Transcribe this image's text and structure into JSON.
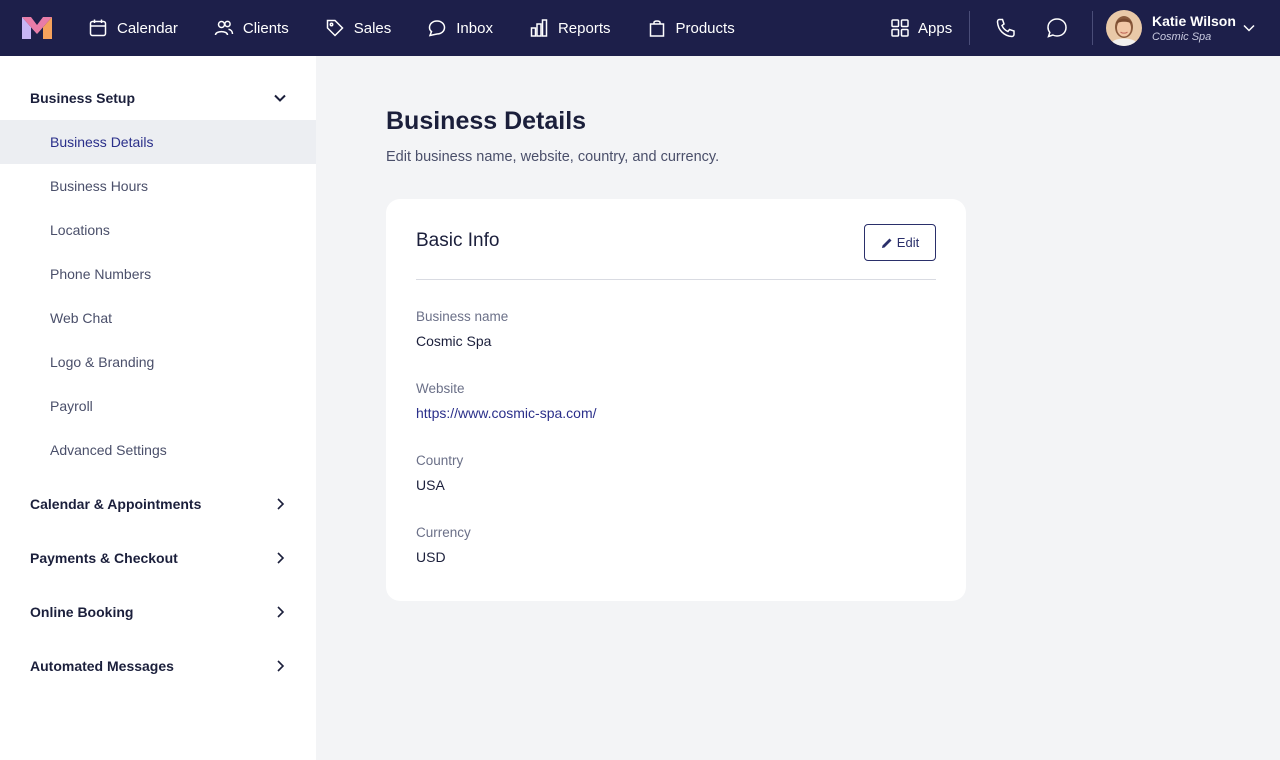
{
  "nav": {
    "items": [
      {
        "label": "Calendar",
        "icon": "calendar-icon"
      },
      {
        "label": "Clients",
        "icon": "users-icon"
      },
      {
        "label": "Sales",
        "icon": "tag-icon"
      },
      {
        "label": "Inbox",
        "icon": "chat-bubble-icon"
      },
      {
        "label": "Reports",
        "icon": "bar-chart-icon"
      },
      {
        "label": "Products",
        "icon": "shopping-bag-icon"
      }
    ],
    "apps_label": "Apps",
    "user_name": "Katie Wilson",
    "user_business": "Cosmic Spa",
    "bg_color": "#1d1f4a"
  },
  "sidebar": {
    "business_setup": "Business Setup",
    "items": [
      "Business Details",
      "Business Hours",
      "Locations",
      "Phone Numbers",
      "Web Chat",
      "Logo & Branding",
      "Payroll",
      "Advanced Settings"
    ],
    "sections": [
      "Calendar & Appointments",
      "Payments & Checkout",
      "Online Booking",
      "Automated Messages"
    ]
  },
  "main": {
    "title": "Business Details",
    "subtitle": "Edit business name, website, country, and currency.",
    "card": {
      "title": "Basic Info",
      "edit_label": "Edit",
      "fields": [
        {
          "label": "Business name",
          "value": "Cosmic Spa"
        },
        {
          "label": "Website",
          "value": "https://www.cosmic-spa.com/"
        },
        {
          "label": "Country",
          "value": "USA"
        },
        {
          "label": "Currency",
          "value": "USD"
        }
      ]
    }
  }
}
